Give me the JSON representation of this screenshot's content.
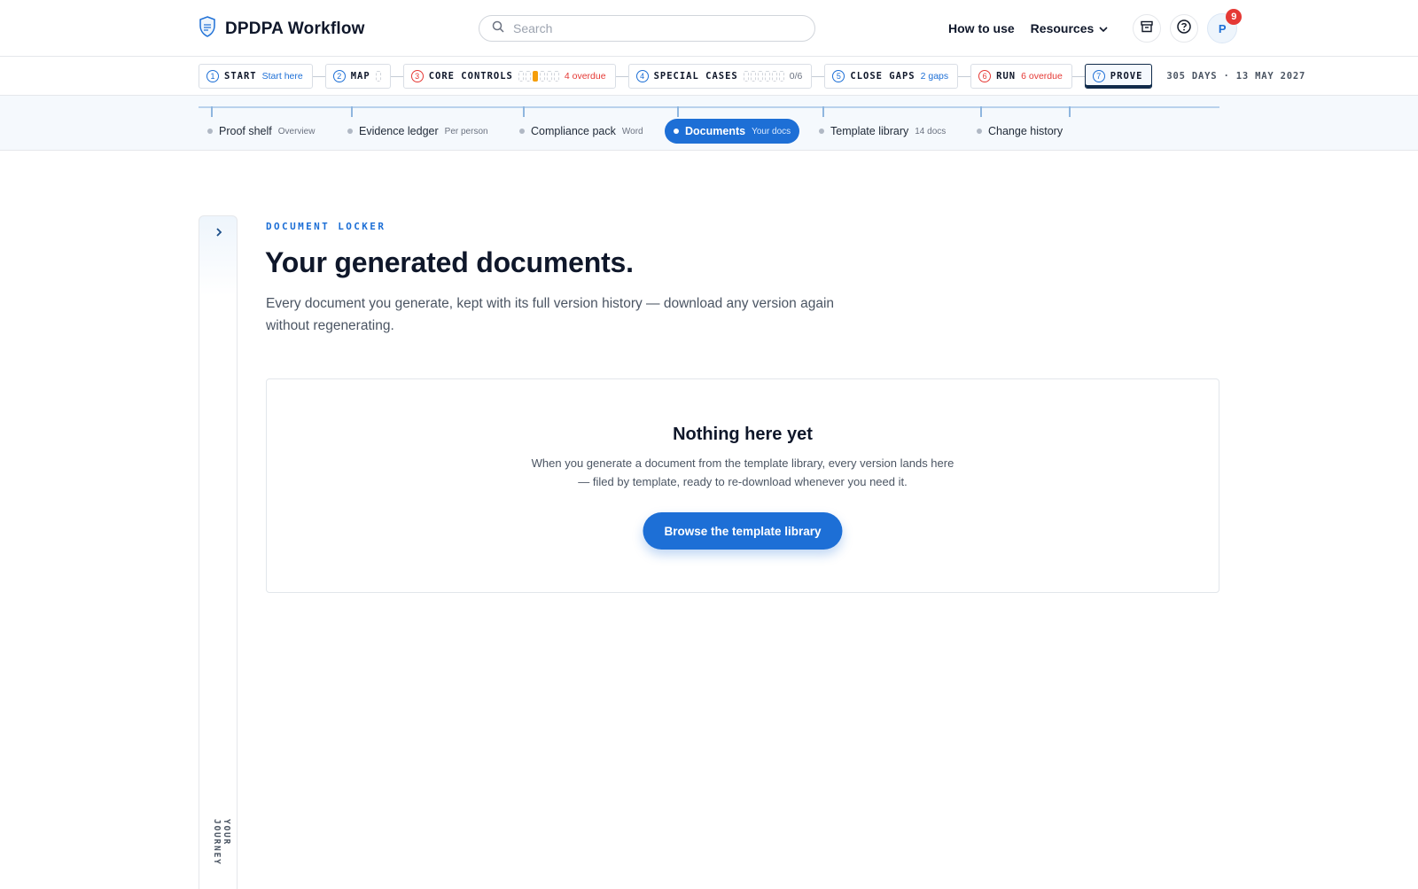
{
  "header": {
    "brand": "DPDPA Workflow",
    "search_placeholder": "Search",
    "nav": {
      "how_to_use": "How to use",
      "resources": "Resources"
    },
    "avatar_initial": "P",
    "notification_count": "9"
  },
  "steps": [
    {
      "num": "1",
      "label": "START",
      "sub": "Start here"
    },
    {
      "num": "2",
      "label": "MAP",
      "sub": ""
    },
    {
      "num": "3",
      "label": "CORE CONTROLS",
      "sub": "4 overdue"
    },
    {
      "num": "4",
      "label": "SPECIAL CASES",
      "sub": "0/6"
    },
    {
      "num": "5",
      "label": "CLOSE GAPS",
      "sub": "2 gaps"
    },
    {
      "num": "6",
      "label": "RUN",
      "sub": "6 overdue"
    },
    {
      "num": "7",
      "label": "PROVE",
      "sub": ""
    }
  ],
  "deadline": "305 DAYS · 13 MAY 2027",
  "subnav": [
    {
      "label": "Proof shelf",
      "sub": "Overview"
    },
    {
      "label": "Evidence ledger",
      "sub": "Per person"
    },
    {
      "label": "Compliance pack",
      "sub": "Word"
    },
    {
      "label": "Documents",
      "sub": "Your docs"
    },
    {
      "label": "Template library",
      "sub": "14 docs"
    },
    {
      "label": "Change history",
      "sub": ""
    }
  ],
  "rail_label": "YOUR JOURNEY",
  "main": {
    "eyebrow": "DOCUMENT LOCKER",
    "title": "Your generated documents.",
    "description": "Every document you generate, kept with its full version history — download any version again without regenerating.",
    "empty": {
      "title": "Nothing here yet",
      "text": "When you generate a document from the template library, every version lands here — filed by template, ready to re-download whenever you need it.",
      "cta": "Browse the template library"
    }
  },
  "colors": {
    "accent": "#1d6fd6",
    "alert": "#e53935",
    "warning": "#f59e0b"
  }
}
